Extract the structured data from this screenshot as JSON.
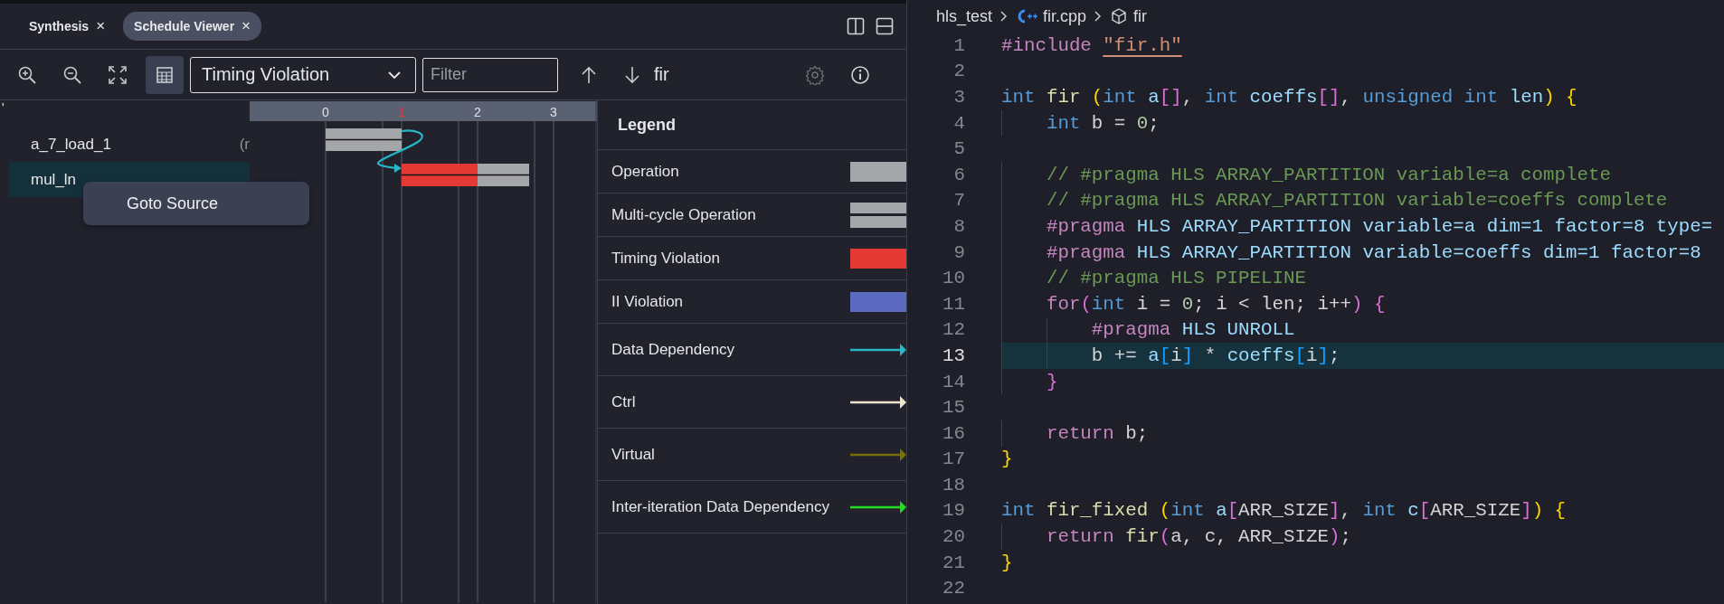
{
  "tabs": [
    {
      "label": "Synthesis",
      "close": "×",
      "selected": false
    },
    {
      "label": "Schedule Viewer",
      "close": "×",
      "selected": true
    }
  ],
  "toolbar": {
    "table_view_selected": true,
    "view_dropdown": "Timing Violation",
    "filter": {
      "placeholder": "Filter"
    },
    "function": "fir",
    "settings_disabled": true
  },
  "operations": {
    "header_mark": "'",
    "rows": [
      {
        "name": "a_7_load_1",
        "detail": "(r",
        "selected": false,
        "timing_violation": false
      },
      {
        "name": "mul_ln",
        "selected": true,
        "timing_violation": true
      }
    ]
  },
  "timeline": {
    "ticks": [
      {
        "label": "0",
        "violation": false
      },
      {
        "label": "1",
        "violation": true
      },
      {
        "label": "2",
        "violation": false
      },
      {
        "label": "3",
        "violation": false
      }
    ]
  },
  "context_menu": {
    "items": [
      "Goto Source"
    ]
  },
  "legend": {
    "title": "Legend",
    "items": [
      {
        "label": "Operation",
        "kind": "bar",
        "color": "#a5a6aa"
      },
      {
        "label": "Multi-cycle Operation",
        "kind": "double-bar",
        "color": "#a5a6aa"
      },
      {
        "label": "Timing Violation",
        "kind": "bar",
        "color": "#e53935"
      },
      {
        "label": "II Violation",
        "kind": "bar",
        "color": "#5c6bc0"
      },
      {
        "label": "Data Dependency",
        "kind": "arrow",
        "color": "#26b8c4"
      },
      {
        "label": "Ctrl",
        "kind": "arrow",
        "color": "#ece4cc"
      },
      {
        "label": "Virtual",
        "kind": "arrow",
        "color": "#7a7000"
      },
      {
        "label": "Inter-iteration Data Dependency",
        "kind": "arrow",
        "color": "#22dd22"
      }
    ]
  },
  "editor": {
    "breadcrumbs": [
      {
        "label": "hls_test",
        "kind": "folder"
      },
      {
        "label": "fir.cpp",
        "kind": "cpp-file"
      },
      {
        "label": "fir",
        "kind": "function"
      }
    ],
    "lines": [
      {
        "number": "1",
        "current": false,
        "tokens": [
          {
            "text": "#include ",
            "kind": "directive"
          },
          {
            "text": "\"fir.h\"",
            "kind": "string"
          }
        ]
      },
      {
        "number": "2",
        "current": false
      },
      {
        "number": "3",
        "current": false,
        "tokens": [
          {
            "text": "int ",
            "kind": "keyword"
          },
          {
            "text": "fir ",
            "kind": "function"
          },
          {
            "text": "(",
            "kind": "bracket1"
          },
          {
            "text": "int ",
            "kind": "keyword"
          },
          {
            "text": "a",
            "kind": "variable"
          },
          {
            "text": "[]",
            "kind": "bracket2"
          },
          {
            "text": ", ",
            "kind": "plain"
          },
          {
            "text": "int ",
            "kind": "keyword"
          },
          {
            "text": "coeffs",
            "kind": "variable"
          },
          {
            "text": "[]",
            "kind": "bracket2"
          },
          {
            "text": ", ",
            "kind": "plain"
          },
          {
            "text": "unsigned int ",
            "kind": "keyword"
          },
          {
            "text": "len",
            "kind": "variable"
          },
          {
            "text": ")",
            "kind": "bracket1"
          },
          {
            "text": " {",
            "kind": "bracket1"
          }
        ]
      },
      {
        "number": "4",
        "current": false,
        "tokens": [
          {
            "text": "    int",
            "kind": "keyword"
          },
          {
            "text": " b = ",
            "kind": "plain"
          },
          {
            "text": "0",
            "kind": "number"
          },
          {
            "text": ";",
            "kind": "plain"
          }
        ]
      },
      {
        "number": "5",
        "current": false
      },
      {
        "number": "6",
        "current": false,
        "tokens": [
          {
            "text": "    // #pragma HLS ARRAY_PARTITION variable=a complete",
            "kind": "comment"
          }
        ]
      },
      {
        "number": "7",
        "current": false,
        "tokens": [
          {
            "text": "    // #pragma HLS ARRAY_PARTITION variable=coeffs complete",
            "kind": "comment"
          }
        ]
      },
      {
        "number": "8",
        "current": false,
        "tokens": [
          {
            "text": "    #pragma",
            "kind": "directive"
          },
          {
            "text": " HLS ARRAY_PARTITION variable=a dim=1 factor=8 type=",
            "kind": "variable"
          }
        ]
      },
      {
        "number": "9",
        "current": false,
        "tokens": [
          {
            "text": "    #pragma",
            "kind": "directive"
          },
          {
            "text": " HLS ARRAY_PARTITION variable=coeffs dim=1 factor=8",
            "kind": "variable"
          }
        ]
      },
      {
        "number": "10",
        "current": false,
        "tokens": [
          {
            "text": "    // #pragma HLS PIPELINE",
            "kind": "comment"
          }
        ]
      },
      {
        "number": "11",
        "current": false,
        "tokens": [
          {
            "text": "    for",
            "kind": "directive"
          },
          {
            "text": "(",
            "kind": "bracket2"
          },
          {
            "text": "int",
            "kind": "keyword"
          },
          {
            "text": " i = ",
            "kind": "plain"
          },
          {
            "text": "0",
            "kind": "number"
          },
          {
            "text": "; i < len; i++",
            "kind": "plain"
          },
          {
            "text": ")",
            "kind": "bracket2"
          },
          {
            "text": " {",
            "kind": "bracket2"
          }
        ]
      },
      {
        "number": "12",
        "current": false,
        "tokens": [
          {
            "text": "        #pragma",
            "kind": "directive"
          },
          {
            "text": " HLS UNROLL",
            "kind": "variable"
          }
        ]
      },
      {
        "number": "13",
        "current": true,
        "tokens": [
          {
            "text": "        b += ",
            "kind": "plain"
          },
          {
            "text": "a",
            "kind": "variable"
          },
          {
            "text": "[",
            "kind": "bracket3"
          },
          {
            "text": "i",
            "kind": "plain"
          },
          {
            "text": "]",
            "kind": "bracket3"
          },
          {
            "text": " * ",
            "kind": "plain"
          },
          {
            "text": "coeffs",
            "kind": "variable"
          },
          {
            "text": "[",
            "kind": "bracket3"
          },
          {
            "text": "i",
            "kind": "plain"
          },
          {
            "text": "]",
            "kind": "bracket3"
          },
          {
            "text": ";",
            "kind": "plain"
          }
        ]
      },
      {
        "number": "14",
        "current": false,
        "tokens": [
          {
            "text": "    }",
            "kind": "bracket2"
          }
        ]
      },
      {
        "number": "15",
        "current": false
      },
      {
        "number": "16",
        "current": false,
        "tokens": [
          {
            "text": "    return",
            "kind": "directive"
          },
          {
            "text": " b;",
            "kind": "plain"
          }
        ]
      },
      {
        "number": "17",
        "current": false,
        "tokens": [
          {
            "text": "}",
            "kind": "bracket1"
          }
        ]
      },
      {
        "number": "18",
        "current": false
      },
      {
        "number": "19",
        "current": false,
        "tokens": [
          {
            "text": "int ",
            "kind": "keyword"
          },
          {
            "text": "fir_fixed ",
            "kind": "function"
          },
          {
            "text": "(",
            "kind": "bracket1"
          },
          {
            "text": "int ",
            "kind": "keyword"
          },
          {
            "text": "a",
            "kind": "variable"
          },
          {
            "text": "[",
            "kind": "bracket2"
          },
          {
            "text": "ARR_SIZE",
            "kind": "plain"
          },
          {
            "text": "]",
            "kind": "bracket2"
          },
          {
            "text": ", ",
            "kind": "plain"
          },
          {
            "text": "int ",
            "kind": "keyword"
          },
          {
            "text": "c",
            "kind": "variable"
          },
          {
            "text": "[",
            "kind": "bracket2"
          },
          {
            "text": "ARR_SIZE",
            "kind": "plain"
          },
          {
            "text": "]",
            "kind": "bracket2"
          },
          {
            "text": ")",
            "kind": "bracket1"
          },
          {
            "text": " {",
            "kind": "bracket1"
          }
        ]
      },
      {
        "number": "20",
        "current": false,
        "tokens": [
          {
            "text": "    return ",
            "kind": "directive"
          },
          {
            "text": "fir",
            "kind": "function"
          },
          {
            "text": "(",
            "kind": "bracket2"
          },
          {
            "text": "a, c, ARR_SIZE",
            "kind": "plain"
          },
          {
            "text": ")",
            "kind": "bracket2"
          },
          {
            "text": ";",
            "kind": "plain"
          }
        ]
      },
      {
        "number": "21",
        "current": false,
        "tokens": [
          {
            "text": "}",
            "kind": "bracket1"
          }
        ]
      },
      {
        "number": "22",
        "current": false
      }
    ]
  }
}
